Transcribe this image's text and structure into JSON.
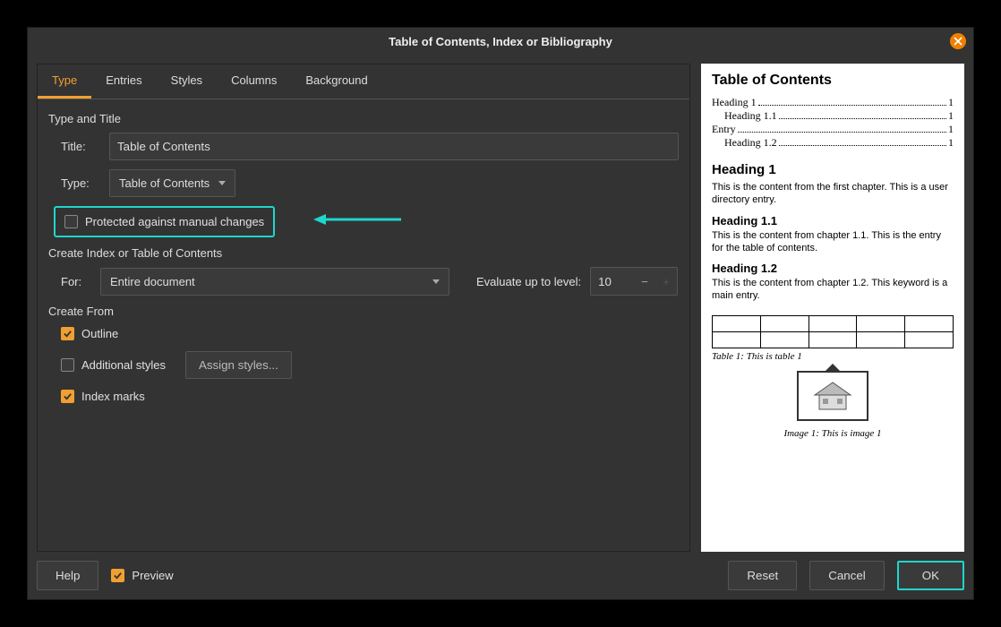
{
  "dialog": {
    "title": "Table of Contents, Index or Bibliography"
  },
  "tabs": [
    "Type",
    "Entries",
    "Styles",
    "Columns",
    "Background"
  ],
  "section": {
    "type_and_title": "Type and Title",
    "title_label": "Title:",
    "title_value": "Table of Contents",
    "type_label": "Type:",
    "type_value": "Table of Contents",
    "protected_label": "Protected against manual changes",
    "create_index": "Create Index or Table of Contents",
    "for_label": "For:",
    "for_value": "Entire document",
    "evaluate_label": "Evaluate up to level:",
    "evaluate_value": "10",
    "create_from": "Create From",
    "outline_label": "Outline",
    "additional_styles_label": "Additional styles",
    "assign_styles_btn": "Assign styles...",
    "index_marks_label": "Index marks"
  },
  "preview": {
    "toc_title": "Table of Contents",
    "toc_items": [
      {
        "text": "Heading 1",
        "page": "1",
        "indent": false
      },
      {
        "text": "Heading 1.1",
        "page": "1",
        "indent": true
      },
      {
        "text": "Entry",
        "page": "1",
        "indent": false
      },
      {
        "text": "Heading 1.2",
        "page": "1",
        "indent": true
      }
    ],
    "h1": "Heading 1",
    "p1": "This is the content from the first chapter. This is a user directory entry.",
    "h11": "Heading 1.1",
    "p2": "This is the content from chapter 1.1. This is the entry for the table of contents.",
    "h12": "Heading 1.2",
    "p3": "This is the content from chapter 1.2. This keyword is a main entry.",
    "table_caption": "Table 1: This is table 1",
    "image_caption": "Image 1: This is image 1"
  },
  "buttons": {
    "help": "Help",
    "preview": "Preview",
    "reset": "Reset",
    "cancel": "Cancel",
    "ok": "OK"
  },
  "colors": {
    "accent": "#f0a030",
    "highlight": "#1fd6cc"
  }
}
